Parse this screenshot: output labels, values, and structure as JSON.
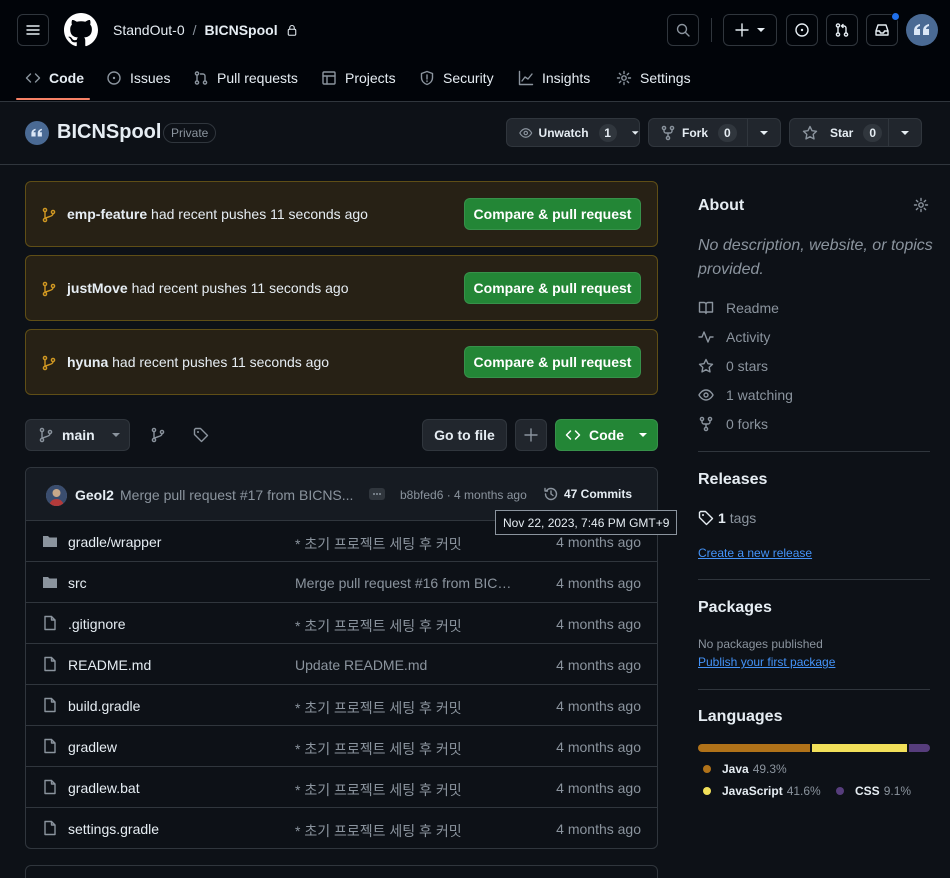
{
  "header": {
    "owner": "StandOut-0",
    "separator": "/",
    "repo": "BICNSpool"
  },
  "tabs": [
    {
      "label": "Code"
    },
    {
      "label": "Issues"
    },
    {
      "label": "Pull requests"
    },
    {
      "label": "Projects"
    },
    {
      "label": "Security"
    },
    {
      "label": "Insights"
    },
    {
      "label": "Settings"
    }
  ],
  "repo_head": {
    "name": "BICNSpool",
    "visibility": "Private",
    "unwatch_label": "Unwatch",
    "unwatch_count": "1",
    "fork_label": "Fork",
    "fork_count": "0",
    "star_label": "Star",
    "star_count": "0"
  },
  "push_banners": [
    {
      "branch": "emp-feature",
      "text": " had recent pushes 11 seconds ago",
      "button": "Compare & pull request"
    },
    {
      "branch": "justMove",
      "text": " had recent pushes 11 seconds ago",
      "button": "Compare & pull request"
    },
    {
      "branch": "hyuna",
      "text": " had recent pushes 11 seconds ago",
      "button": "Compare & pull request"
    }
  ],
  "toolbar": {
    "branch": "main",
    "go_to_file": "Go to file",
    "add": "+",
    "code": "Code"
  },
  "commit": {
    "author": "Geol2",
    "message": "Merge pull request #17 from BICNS...",
    "sha_time": "b8bfed6 · 4 months ago",
    "commits": "47 Commits",
    "tooltip": "Nov 22, 2023, 7:46 PM GMT+9"
  },
  "files": [
    {
      "type": "dir",
      "name": "gradle/wrapper",
      "message": "* 초기 프로젝트 세팅 후 커밋",
      "date": "4 months ago"
    },
    {
      "type": "dir",
      "name": "src",
      "message": "Merge pull request #16 from BICNS...",
      "date": "4 months ago"
    },
    {
      "type": "file",
      "name": ".gitignore",
      "message": "* 초기 프로젝트 세팅 후 커밋",
      "date": "4 months ago"
    },
    {
      "type": "file",
      "name": "README.md",
      "message": "Update README.md",
      "date": "4 months ago"
    },
    {
      "type": "file",
      "name": "build.gradle",
      "message": "* 초기 프로젝트 세팅 후 커밋",
      "date": "4 months ago"
    },
    {
      "type": "file",
      "name": "gradlew",
      "message": "* 초기 프로젝트 세팅 후 커밋",
      "date": "4 months ago"
    },
    {
      "type": "file",
      "name": "gradlew.bat",
      "message": "* 초기 프로젝트 세팅 후 커밋",
      "date": "4 months ago"
    },
    {
      "type": "file",
      "name": "settings.gradle",
      "message": "* 초기 프로젝트 세팅 후 커밋",
      "date": "4 months ago"
    }
  ],
  "about": {
    "title": "About",
    "description": "No description, website, or topics provided.",
    "readme": "Readme",
    "activity": "Activity",
    "stars": "0 stars",
    "watching": "1 watching",
    "forks": "0 forks"
  },
  "releases": {
    "title": "Releases",
    "tags_count": "1",
    "tags_label": " tags",
    "create_link": "Create a new release"
  },
  "packages": {
    "title": "Packages",
    "none": "No packages published",
    "publish_link": "Publish your first package"
  },
  "languages": {
    "title": "Languages",
    "items": [
      {
        "name": "Java",
        "percent": "49.3%",
        "color": "#b07219",
        "value": 49.3
      },
      {
        "name": "JavaScript",
        "percent": "41.6%",
        "color": "#f1e05a",
        "value": 41.6
      },
      {
        "name": "CSS",
        "percent": "9.1%",
        "color": "#563d7c",
        "value": 9.1
      }
    ]
  },
  "colors": {
    "accent_tab": "#f78166",
    "green": "#238636",
    "link": "#4493f8",
    "notification_dot": "#1f6feb"
  }
}
